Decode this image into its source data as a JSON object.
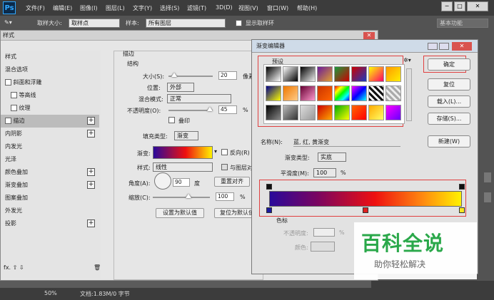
{
  "menubar": {
    "logo": "Ps",
    "items": [
      "文件(F)",
      "编辑(E)",
      "图像(I)",
      "图层(L)",
      "文字(Y)",
      "选择(S)",
      "滤镜(T)",
      "3D(D)",
      "视图(V)",
      "窗口(W)",
      "帮助(H)"
    ]
  },
  "options": {
    "sample_size_label": "取样大小:",
    "sample_size_value": "取样点",
    "sample_label": "样本:",
    "sample_value": "所有图层",
    "show_ring": "显示取样环",
    "workspace": "基本功能"
  },
  "layer_style": {
    "title": "样式",
    "items": [
      {
        "label": "样式"
      },
      {
        "label": "混合选项"
      },
      {
        "label": "斜面和浮雕"
      },
      {
        "label": "等高线"
      },
      {
        "label": "纹理"
      },
      {
        "label": "描边"
      },
      {
        "label": "内阴影"
      },
      {
        "label": "内发光"
      },
      {
        "label": "光泽"
      },
      {
        "label": "颜色叠加"
      },
      {
        "label": "渐变叠加"
      },
      {
        "label": "图案叠加"
      },
      {
        "label": "外发光"
      },
      {
        "label": "投影"
      }
    ],
    "stroke": {
      "section": "描边",
      "structure": "结构",
      "size_label": "大小(S):",
      "size_value": "20",
      "size_unit": "像素",
      "position_label": "位置:",
      "position_value": "外部",
      "blend_label": "混合模式:",
      "blend_value": "正常",
      "opacity_label": "不透明度(O):",
      "opacity_value": "45",
      "opacity_unit": "%",
      "overprint": "叠印",
      "fill_type_label": "填充类型:",
      "fill_type_value": "渐变",
      "gradient_label": "渐变:",
      "reverse": "反向(R)",
      "style_label": "样式:",
      "style_value": "线性",
      "align": "与图层对齐",
      "angle_label": "角度(A):",
      "angle_value": "90",
      "angle_unit": "度",
      "reset_align": "重置对齐",
      "scale_label": "缩放(C):",
      "scale_value": "100",
      "scale_unit": "%",
      "set_default": "设置为默认值",
      "reset_default": "复位为默认值"
    }
  },
  "gradient_editor": {
    "title": "渐变编辑器",
    "presets_label": "预设",
    "ok": "确定",
    "reset": "复位",
    "load": "载入(L)...",
    "save": "存储(S)...",
    "name_label": "名称(N):",
    "name_value": "蓝, 红, 黄渐变",
    "new_button": "新建(W)",
    "type_label": "渐变类型:",
    "type_value": "实底",
    "smooth_label": "平滑度(M):",
    "smooth_value": "100",
    "smooth_unit": "%",
    "stops_section": "色标",
    "opacity_label": "不透明度:",
    "opacity_unit": "%",
    "color_label": "颜色:"
  },
  "status": {
    "zoom": "50%",
    "doc": "文档:1.83M/0 字节"
  },
  "watermark": {
    "title": "百科全说",
    "subtitle": "助你轻松解决"
  },
  "colors": {
    "accent_red": "#e04040",
    "watermark_green": "#2aa84a"
  }
}
